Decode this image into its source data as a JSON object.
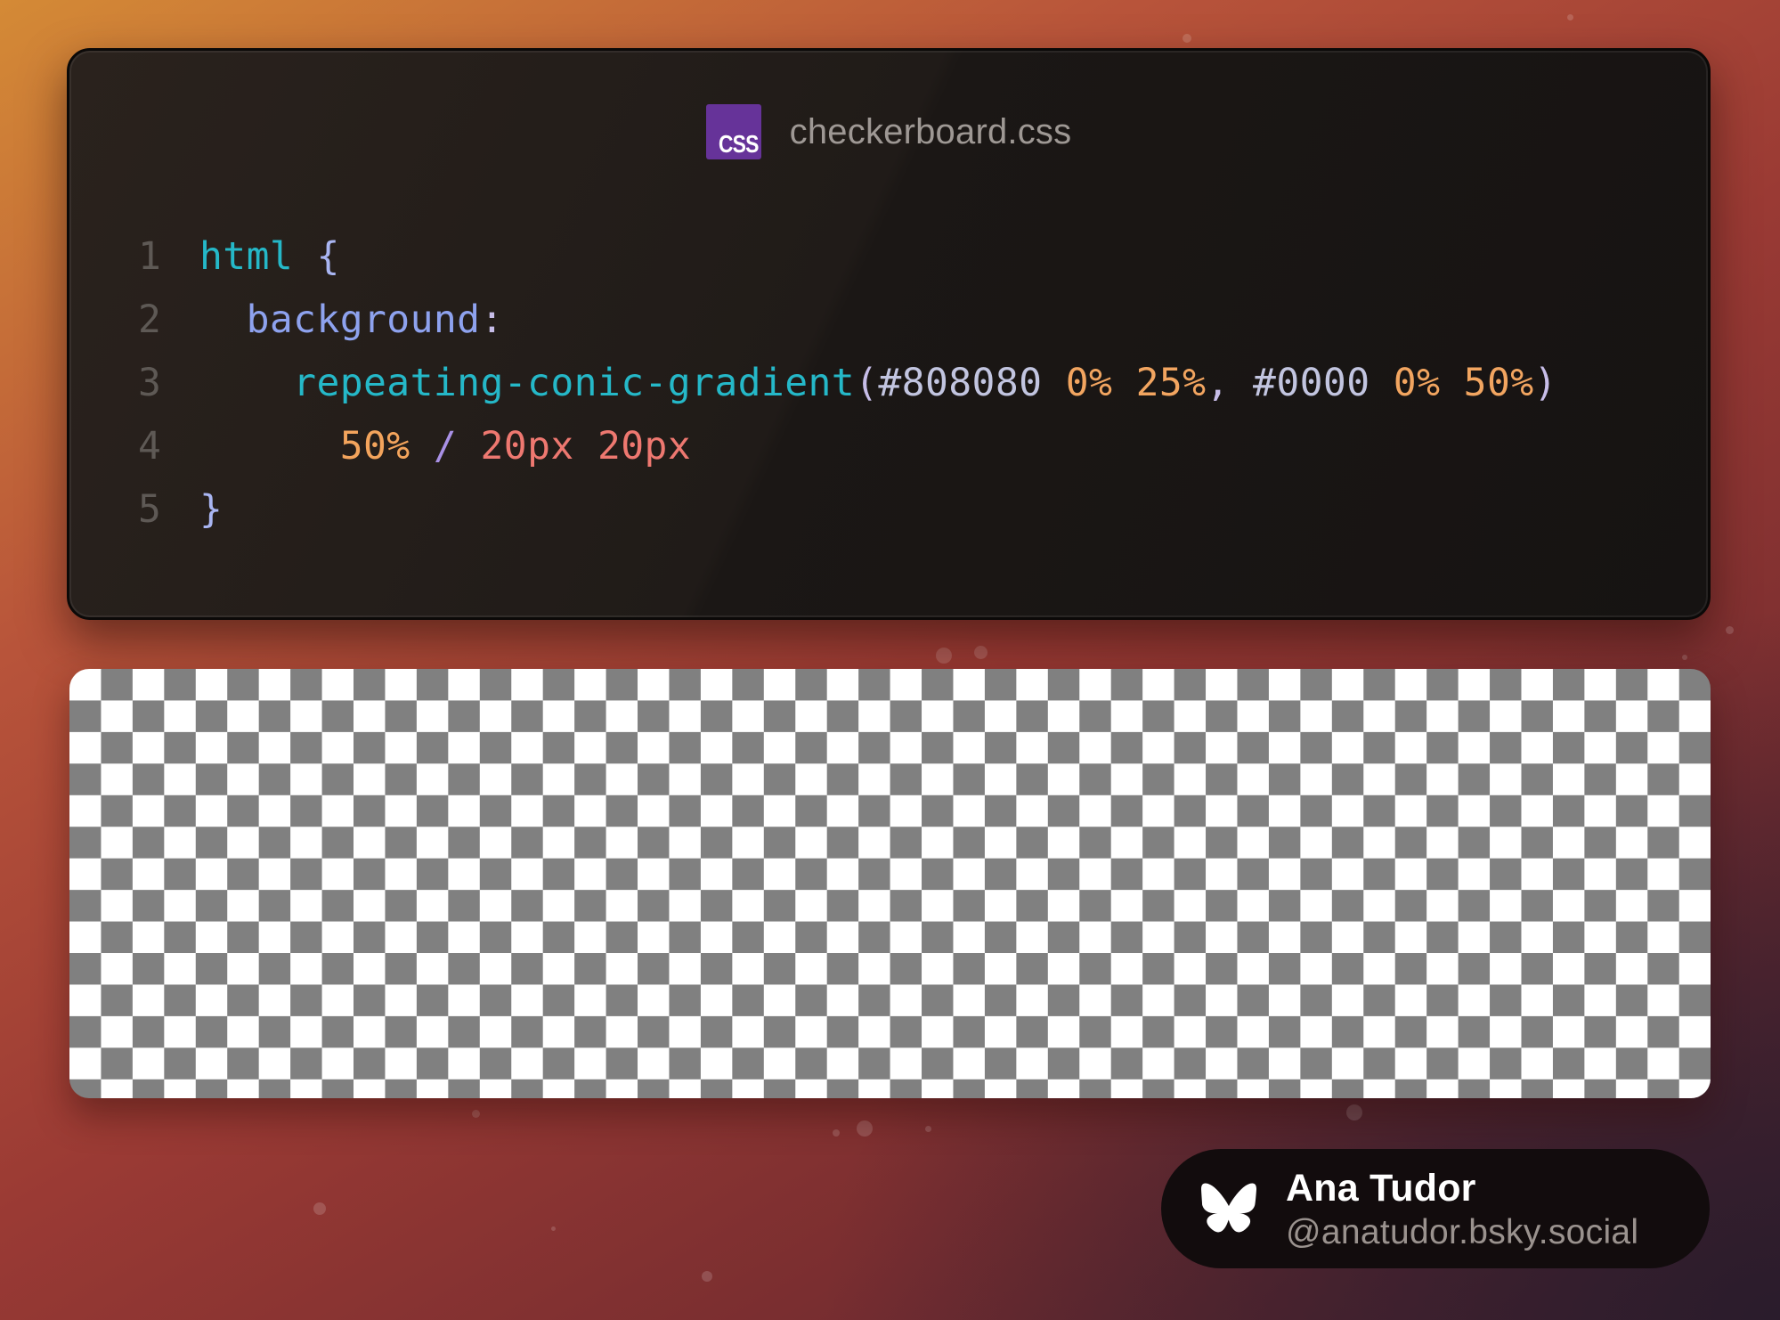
{
  "file": {
    "icon": "css-file-icon",
    "badge_label": "CSS",
    "name": "checkerboard.css"
  },
  "code": {
    "lines": [
      {
        "num": "1",
        "tokens": [
          [
            "html",
            "sel"
          ],
          [
            " ",
            "plain"
          ],
          [
            "{",
            "brace"
          ]
        ]
      },
      {
        "num": "2",
        "tokens": [
          [
            "  ",
            "plain"
          ],
          [
            "background",
            "prop"
          ],
          [
            ":",
            "punct"
          ]
        ]
      },
      {
        "num": "3",
        "tokens": [
          [
            "    ",
            "plain"
          ],
          [
            "repeating-conic-gradient",
            "fn"
          ],
          [
            "(",
            "punct"
          ],
          [
            "#808080",
            "hex"
          ],
          [
            " ",
            "plain"
          ],
          [
            "0%",
            "num"
          ],
          [
            " ",
            "plain"
          ],
          [
            "25%",
            "num"
          ],
          [
            ",",
            "punct"
          ],
          [
            " ",
            "plain"
          ],
          [
            "#0000",
            "hex"
          ],
          [
            " ",
            "plain"
          ],
          [
            "0%",
            "num"
          ],
          [
            " ",
            "plain"
          ],
          [
            "50%",
            "num"
          ],
          [
            ")",
            "punct"
          ]
        ]
      },
      {
        "num": "4",
        "tokens": [
          [
            "      ",
            "plain"
          ],
          [
            "50%",
            "pos"
          ],
          [
            " ",
            "plain"
          ],
          [
            "/",
            "slash"
          ],
          [
            " ",
            "plain"
          ],
          [
            "20px",
            "px"
          ],
          [
            " ",
            "plain"
          ],
          [
            "20px",
            "px"
          ]
        ]
      },
      {
        "num": "5",
        "tokens": [
          [
            "}",
            "brace"
          ]
        ]
      }
    ]
  },
  "preview": {
    "pattern": "checkerboard",
    "colors": [
      "#808080",
      "#ffffff"
    ]
  },
  "author": {
    "icon": "bluesky-butterfly-icon",
    "name": "Ana Tudor",
    "handle": "@anatudor.bsky.social"
  },
  "colors": {
    "selector": "#25b8c8",
    "property": "#8ea2ee",
    "number": "#f2a560",
    "unit": "#ee7870",
    "css_badge": "#663399"
  }
}
